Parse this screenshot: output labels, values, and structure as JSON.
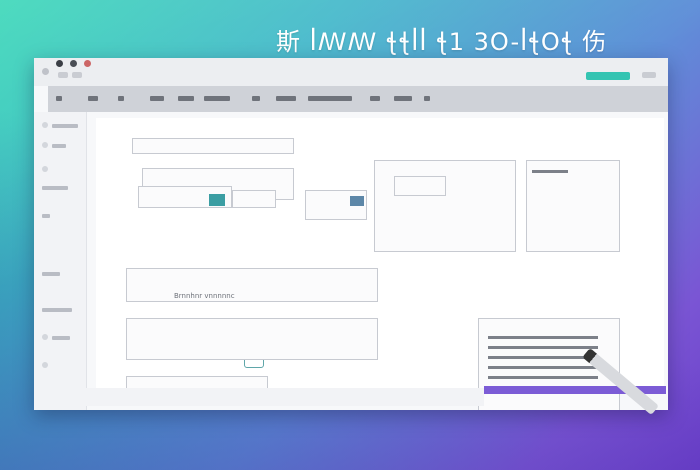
{
  "hero": {
    "title": "斯 ꟾꟿꟿ ꞎꞎꟾꟾ  ꞎ1 3O-ꟾꞎOꞎ 伤"
  },
  "window": {
    "titlebar": {
      "cta_label": ""
    },
    "section_label": "Brnnhnr vnnnnnc"
  },
  "colors": {
    "accent": "#34c4b2",
    "brand": "#7c5cd6",
    "chart": "#3b9ea3"
  },
  "icons": [
    "close-icon",
    "minimize-icon",
    "maximize-icon",
    "pen-icon",
    "logo-icon"
  ]
}
